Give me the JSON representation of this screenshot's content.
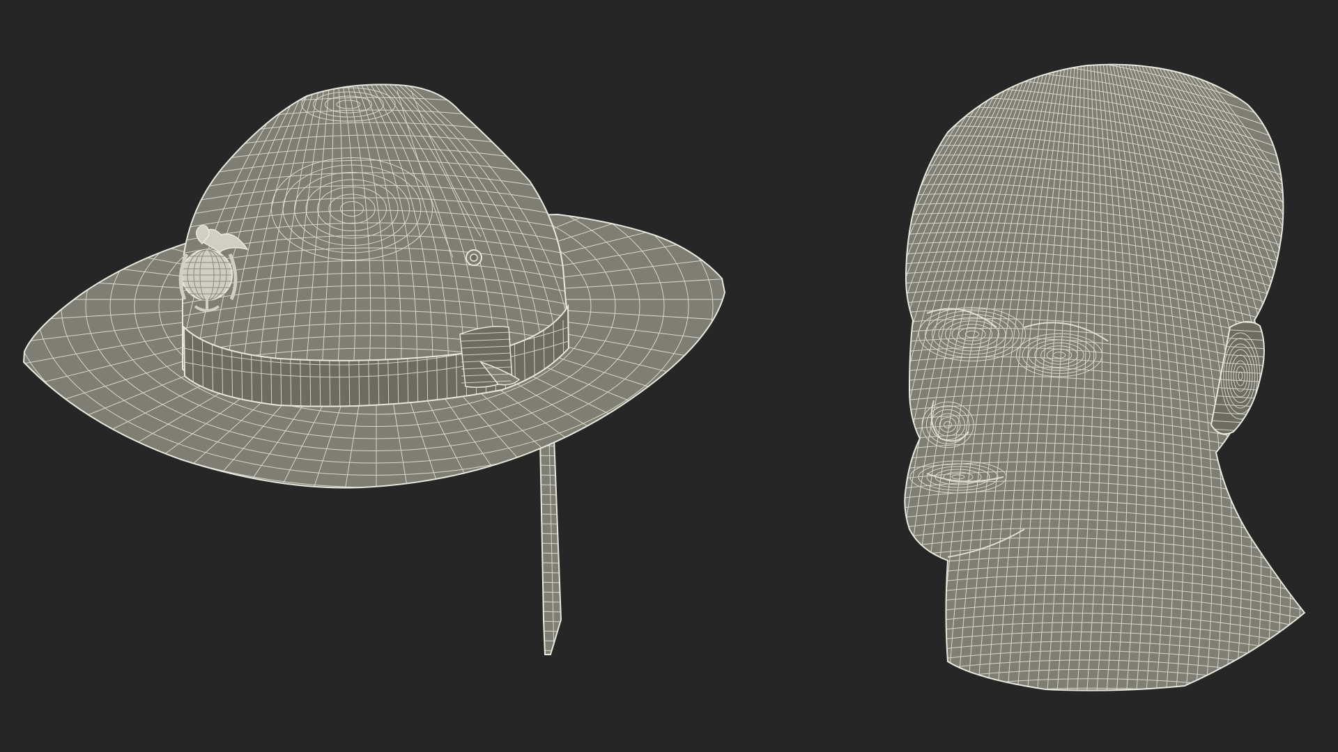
{
  "scene": {
    "background_color": "#262626",
    "mesh_fill_color": "#7e7e74",
    "mesh_shade_color": "#6c6c63",
    "wire_color": "#e8e8de",
    "badge_color": "#cfcfc6",
    "objects": [
      {
        "name": "campaign-hat",
        "kind": "wireframe-3d-model",
        "parts": [
          "brim",
          "crown",
          "hat-band",
          "eagle-globe-anchor-badge",
          "eyelet",
          "chin-strap"
        ]
      },
      {
        "name": "human-head",
        "kind": "wireframe-3d-model",
        "parts": [
          "cranium",
          "face",
          "ear",
          "neck"
        ]
      }
    ]
  }
}
